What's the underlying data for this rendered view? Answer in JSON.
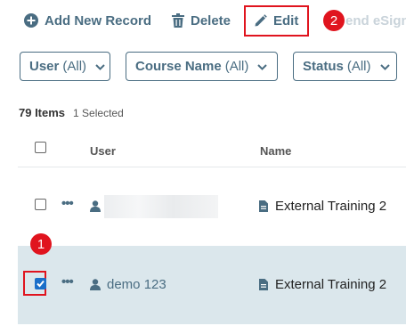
{
  "toolbar": {
    "add_label": "Add New Record",
    "delete_label": "Delete",
    "edit_label": "Edit",
    "esign_label": "end eSign"
  },
  "callouts": {
    "one": "1",
    "two": "2"
  },
  "filters": [
    {
      "name": "User",
      "value": "(All)"
    },
    {
      "name": "Course Name",
      "value": "(All)"
    },
    {
      "name": "Status",
      "value": "(All)"
    }
  ],
  "summary": {
    "items": "79 Items",
    "selected": "1 Selected"
  },
  "table": {
    "headers": {
      "user": "User",
      "name": "Name"
    },
    "rows": [
      {
        "user": "",
        "name": "External Training 2",
        "checked": false
      },
      {
        "user": "demo 123",
        "name": "External Training 2",
        "checked": true
      }
    ]
  },
  "colors": {
    "accent": "#4a6d82",
    "highlight": "#e0141e",
    "selected_row": "#dbe7ec",
    "checkbox": "#1a6fc9"
  },
  "icons": [
    "plus-circle-icon",
    "trash-icon",
    "pencil-icon",
    "chevron-down-icon",
    "more-icon",
    "user-icon",
    "document-icon",
    "checkbox-icon"
  ]
}
